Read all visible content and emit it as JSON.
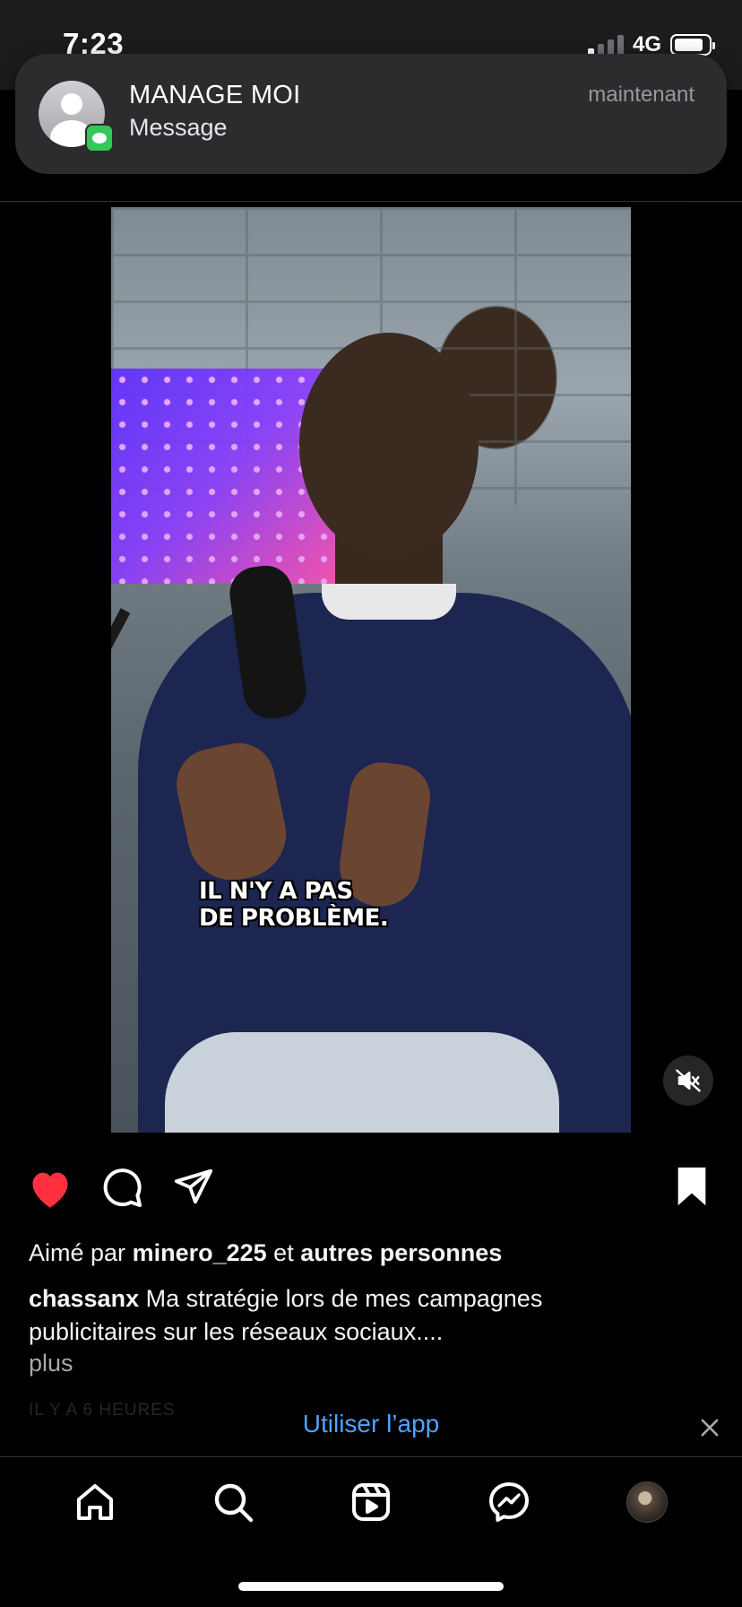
{
  "status_bar": {
    "time": "7:23",
    "network": "4G",
    "battery_level": 0.85
  },
  "notification": {
    "title": "MANAGE MOI",
    "subtitle": "Message",
    "time": "maintenant",
    "avatar_icon": "person-placeholder-icon",
    "app_badge_icon": "messages-app-icon",
    "badge_color": "#34c759"
  },
  "post": {
    "video_caption": "IL N'Y A PAS\nDE PROBLÈME.",
    "muted_icon": "speaker-muted-icon",
    "liked": true,
    "like_color": "#ff3040",
    "saved": true,
    "likes": {
      "prefix": "Aimé par",
      "user": "minero_225",
      "joiner": "et",
      "others": "autres personnes"
    },
    "author": "chassanx",
    "caption": "Ma stratégie lors de mes campagnes publicitaires sur les réseaux sociaux....",
    "more_label": "plus",
    "timestamp": "IL Y A 6 HEURES"
  },
  "banner": {
    "use_app_label": "Utiliser l’app",
    "link_color": "#4da3ff"
  },
  "tabbar": {
    "items": [
      "home-icon",
      "search-icon",
      "reels-icon",
      "messenger-icon",
      "profile-avatar"
    ]
  }
}
